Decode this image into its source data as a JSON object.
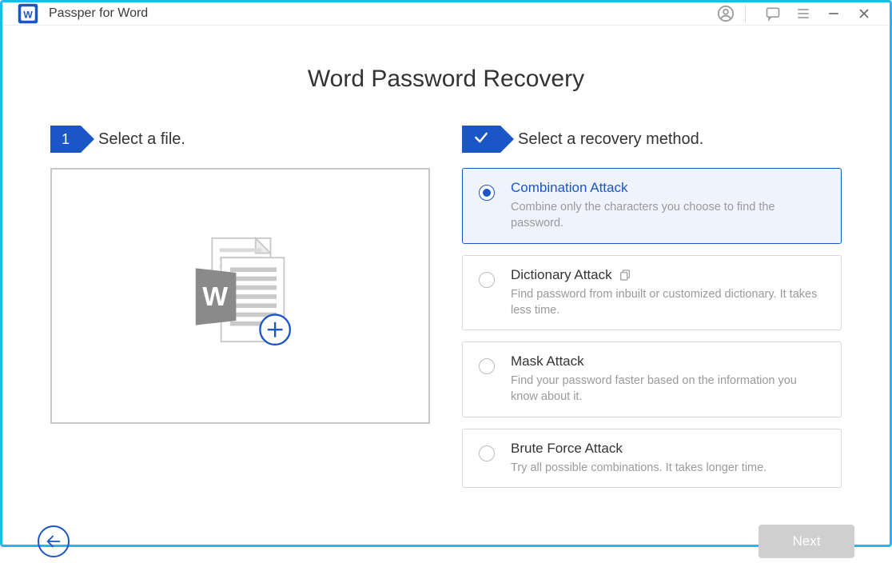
{
  "app": {
    "title": "Passper for Word"
  },
  "page": {
    "title": "Word Password Recovery"
  },
  "step1": {
    "chip": "1",
    "label": "Select a file."
  },
  "step2": {
    "label": "Select a recovery method."
  },
  "methods": [
    {
      "title": "Combination Attack",
      "desc": "Combine only the characters you choose to find the password.",
      "selected": true,
      "has_copy_icon": false
    },
    {
      "title": "Dictionary Attack",
      "desc": "Find password from inbuilt or customized dictionary. It takes less time.",
      "selected": false,
      "has_copy_icon": true
    },
    {
      "title": "Mask Attack",
      "desc": "Find your password faster based on the information you know about it.",
      "selected": false,
      "has_copy_icon": false
    },
    {
      "title": "Brute Force Attack",
      "desc": "Try all possible combinations. It takes longer time.",
      "selected": false,
      "has_copy_icon": false
    }
  ],
  "buttons": {
    "next": "Next"
  },
  "colors": {
    "accent": "#1B56C7",
    "border": "#1FBAED"
  }
}
